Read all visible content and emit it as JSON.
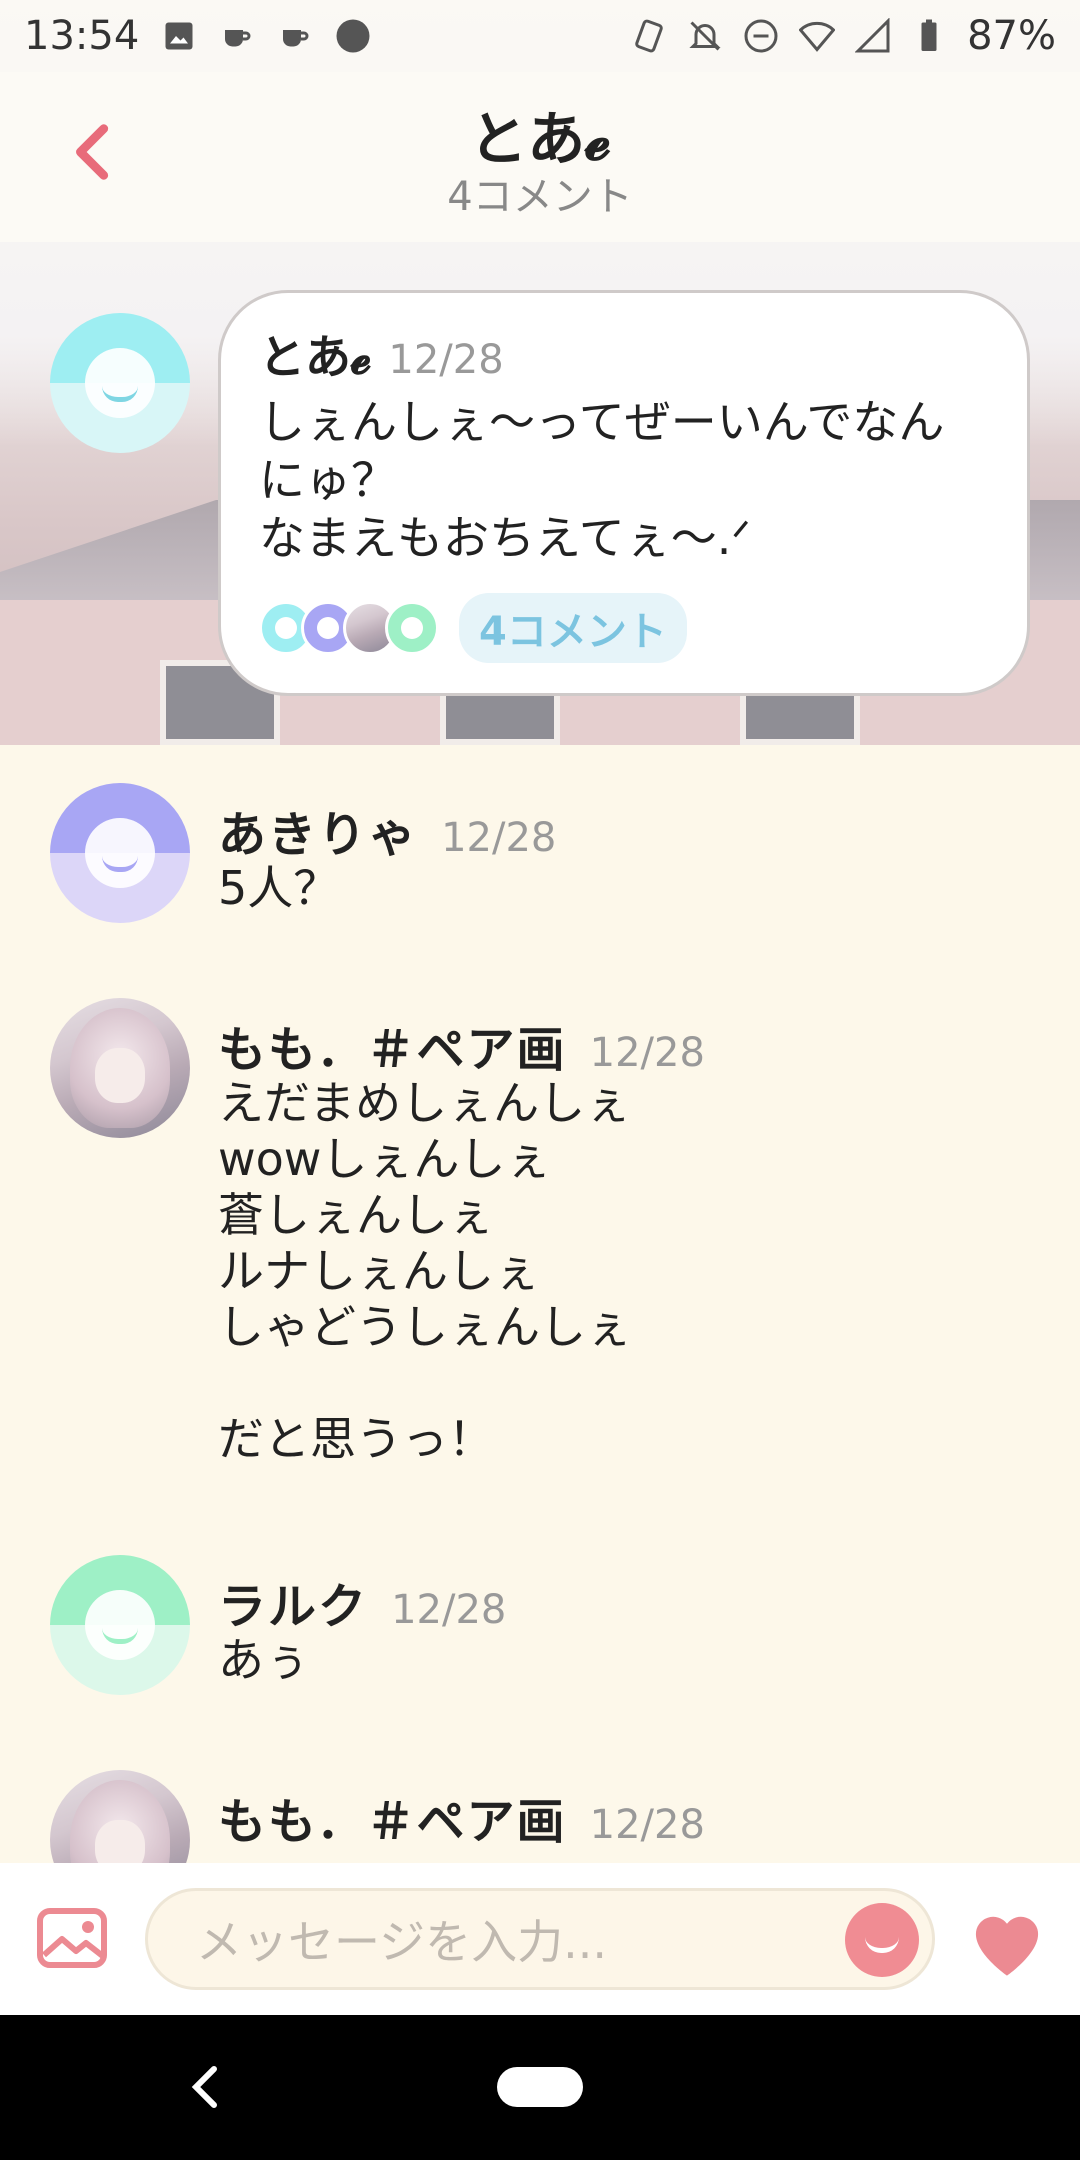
{
  "status_bar": {
    "time": "13:54",
    "battery": "87%",
    "left_icons": [
      "image-icon",
      "cup-icon",
      "cup-icon",
      "circle-icon"
    ],
    "right_icons": [
      "nfc-icon",
      "bell-off-icon",
      "dnd-icon",
      "wifi-icon",
      "signal-icon",
      "battery-icon"
    ]
  },
  "header": {
    "title": "とあ𝓮",
    "subtitle": "4コメント",
    "accent": "#e86b7a"
  },
  "post": {
    "name": "とあ𝓮",
    "date": "12/28",
    "body": "しぇんしぇ〜ってぜーいんでなん\nにゅ？\nなまえもおちえてぇ〜.ᐟ",
    "comment_count_label": "4コメント",
    "avatar_color_top": "#9eeef2",
    "avatar_color_bottom": "#d8f6f7"
  },
  "comments": [
    {
      "name": "あきりゃ",
      "date": "12/28",
      "body": "5人？",
      "avatar": "smile",
      "avatar_color_top": "#a8a6f4",
      "avatar_color_bottom": "#dcd6f8"
    },
    {
      "name": "もも．＃ペア画",
      "date": "12/28",
      "body": "えだまめしぇんしぇ\nwowしぇんしぇ\n蒼しぇんしぇ\nルナしぇんしぇ\nしゃどうしぇんしぇ\n\nだと思うっ！",
      "avatar": "photo"
    },
    {
      "name": "ラルク",
      "date": "12/28",
      "body": "あぅ",
      "avatar": "smile",
      "avatar_color_top": "#9ef0c6",
      "avatar_color_bottom": "#dcf8ea"
    },
    {
      "name": "もも．＃ペア画",
      "date": "12/28",
      "body": "",
      "avatar": "photo"
    }
  ],
  "input_bar": {
    "placeholder": "メッセージを入力...",
    "accent": "#f08c93"
  }
}
